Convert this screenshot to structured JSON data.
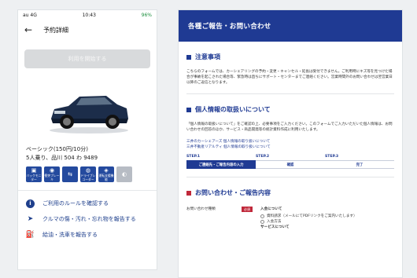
{
  "phone": {
    "status": {
      "carrier": "au 4G",
      "time": "10:43",
      "battery": "96%"
    },
    "appbar": {
      "back_icon": "←",
      "title": "予約詳細"
    },
    "disabled_button": "利用を開始する",
    "car": {
      "plan": "ベーシック(150円/10分)",
      "seats_plate": "5人乗り、品川 504 わ 9489"
    },
    "features": [
      {
        "icon": "camera-icon",
        "glyph": "▣",
        "label": "バックモニター"
      },
      {
        "icon": "brake-icon",
        "glyph": "◉",
        "label": "衝突ブレーキ"
      },
      {
        "icon": "car-icon",
        "glyph": "⇆",
        "label": ""
      },
      {
        "icon": "recorder-icon",
        "glyph": "◍",
        "label": "ドライブレコーダー"
      },
      {
        "icon": "cruise-icon",
        "glyph": "◈",
        "label": "運転支援機能"
      },
      {
        "icon": "seat-icon",
        "glyph": "◐",
        "label": ""
      }
    ],
    "menu": [
      {
        "icon": "info-icon",
        "glyph": "i",
        "label": "ご利用のルールを確認する"
      },
      {
        "icon": "send-icon",
        "glyph": "➤",
        "label": "クルマの傷・汚れ・忘れ物を報告する"
      },
      {
        "icon": "fuel-icon",
        "glyph": "⛽",
        "label": "給油・洗車を報告する"
      }
    ]
  },
  "web": {
    "header": "各種ご報告・お問い合わせ",
    "notice": {
      "title": "注意事項",
      "text": "こちらのフォームでは、カーシェアリングの予約・変更・キャンセル・延長は受付できません。ご利用時にキズ等を見つけた場合が事故を起こされた場合等、緊急時は直ちにサポート・センターまでご連絡ください。営業時間外のお問い合わせは翌営業日以降のご返信となります。"
    },
    "privacy": {
      "title": "個人情報の取扱いについて",
      "text": "「個人情報の取扱いについて」をご確認の上、必要事項をご入力ください。このフォームでご入力いただいた個人情報は、お問い合わせの回答のほか、サービス・商品開発等の統計資料作成に利用いたします。",
      "links": [
        "三井のカーシェアーズ 個人情報の取り扱いについて",
        "三井不動産リアルティ 個人情報の取り扱いについて"
      ]
    },
    "steps": {
      "labels": [
        "STEP.1",
        "STEP.2",
        "STEP.3"
      ],
      "items": [
        "ご連絡先・ご報告内容の入力",
        "確認",
        "完了"
      ]
    },
    "inquiry": {
      "title": "お問い合わせ・ご報告内容",
      "field_label": "お問い合わせ種類",
      "required": "必須",
      "group_heading": "入会について",
      "options": [
        "資料請求（メールにてPDFリンクをご案内いたします）",
        "入会方法"
      ],
      "next_heading": "サービスについて"
    }
  }
}
